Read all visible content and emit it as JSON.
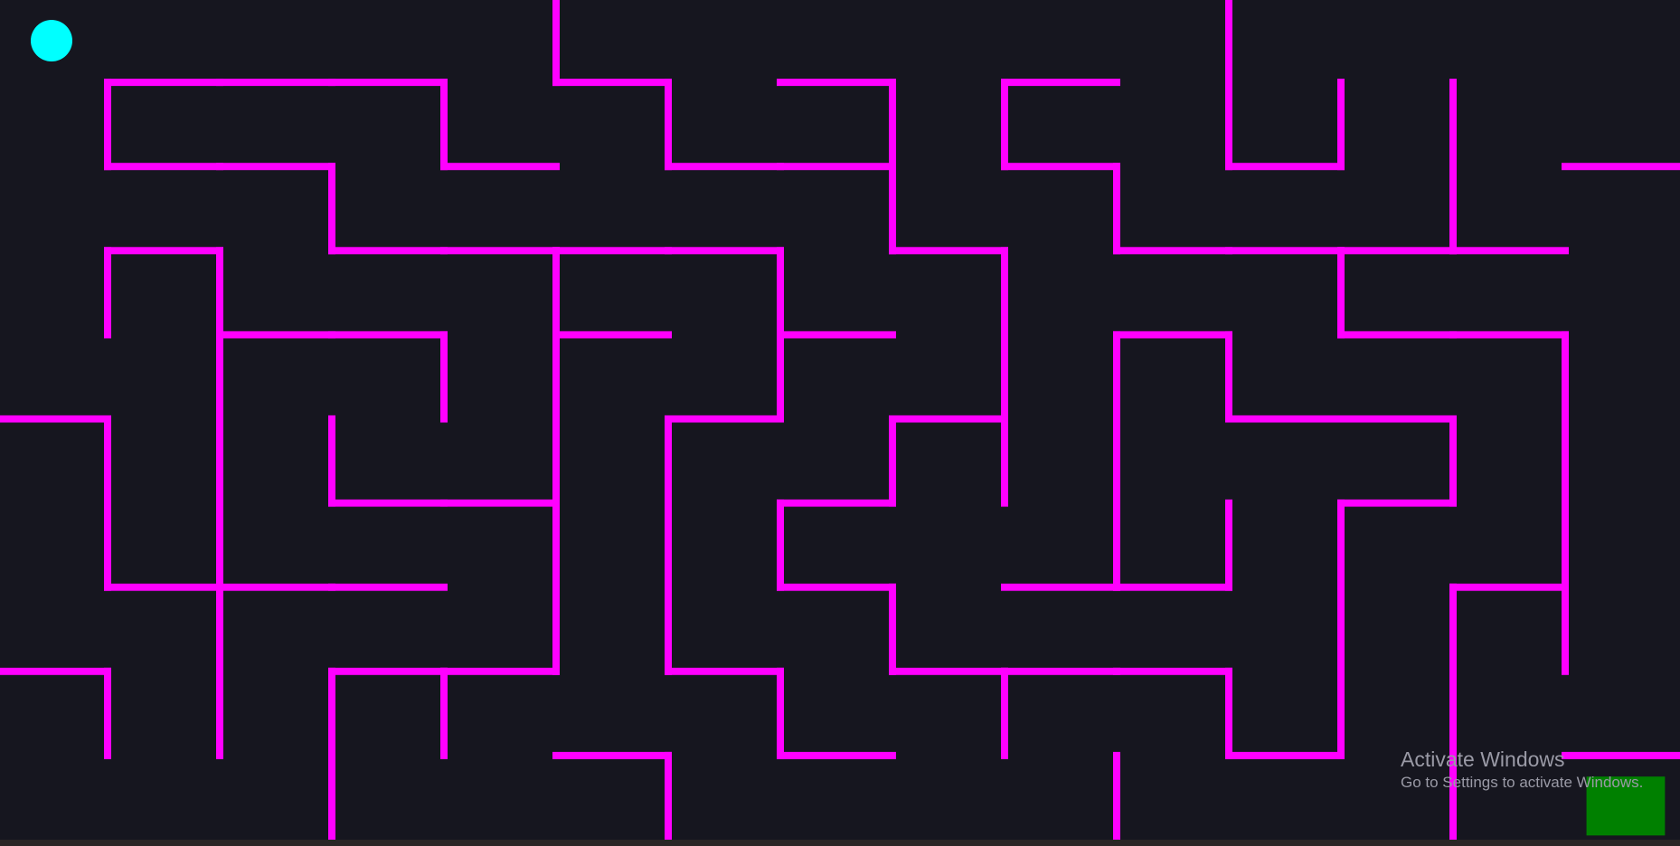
{
  "game": {
    "colors": {
      "background": "#16161f",
      "wall": "#ff00ff",
      "player": "#00ffff",
      "goal": "#008000"
    },
    "grid": {
      "rows": 10,
      "cols": 15
    },
    "player": {
      "row": 0,
      "col": 0
    },
    "goal": {
      "row": 9,
      "col": 14
    },
    "walls": {
      "horizontal": [
        [
          1,
          1
        ],
        [
          1,
          2
        ],
        [
          1,
          3
        ],
        [
          1,
          5
        ],
        [
          1,
          7
        ],
        [
          1,
          9
        ],
        [
          2,
          1
        ],
        [
          2,
          2
        ],
        [
          2,
          4
        ],
        [
          2,
          6
        ],
        [
          2,
          7
        ],
        [
          2,
          9
        ],
        [
          2,
          11
        ],
        [
          2,
          14
        ],
        [
          3,
          1
        ],
        [
          3,
          3
        ],
        [
          3,
          4
        ],
        [
          3,
          5
        ],
        [
          3,
          6
        ],
        [
          3,
          8
        ],
        [
          3,
          10
        ],
        [
          3,
          11
        ],
        [
          3,
          12
        ],
        [
          3,
          13
        ],
        [
          4,
          2
        ],
        [
          4,
          3
        ],
        [
          4,
          5
        ],
        [
          4,
          7
        ],
        [
          4,
          10
        ],
        [
          4,
          12
        ],
        [
          4,
          13
        ],
        [
          5,
          0
        ],
        [
          5,
          6
        ],
        [
          5,
          8
        ],
        [
          5,
          11
        ],
        [
          5,
          12
        ],
        [
          6,
          3
        ],
        [
          6,
          4
        ],
        [
          6,
          7
        ],
        [
          6,
          12
        ],
        [
          7,
          1
        ],
        [
          7,
          2
        ],
        [
          7,
          3
        ],
        [
          7,
          7
        ],
        [
          7,
          9
        ],
        [
          7,
          10
        ],
        [
          7,
          13
        ],
        [
          8,
          0
        ],
        [
          8,
          3
        ],
        [
          8,
          4
        ],
        [
          8,
          6
        ],
        [
          8,
          8
        ],
        [
          8,
          9
        ],
        [
          8,
          10
        ],
        [
          9,
          5
        ],
        [
          9,
          7
        ],
        [
          9,
          11
        ],
        [
          9,
          14
        ]
      ],
      "vertical": [
        [
          0,
          5
        ],
        [
          0,
          11
        ],
        [
          1,
          1
        ],
        [
          1,
          4
        ],
        [
          1,
          6
        ],
        [
          1,
          8
        ],
        [
          1,
          9
        ],
        [
          1,
          11
        ],
        [
          1,
          12
        ],
        [
          1,
          13
        ],
        [
          2,
          3
        ],
        [
          2,
          8
        ],
        [
          2,
          10
        ],
        [
          2,
          13
        ],
        [
          3,
          1
        ],
        [
          3,
          2
        ],
        [
          3,
          5
        ],
        [
          3,
          7
        ],
        [
          3,
          9
        ],
        [
          3,
          12
        ],
        [
          4,
          2
        ],
        [
          4,
          4
        ],
        [
          4,
          5
        ],
        [
          4,
          7
        ],
        [
          4,
          9
        ],
        [
          4,
          10
        ],
        [
          4,
          11
        ],
        [
          4,
          14
        ],
        [
          5,
          1
        ],
        [
          5,
          2
        ],
        [
          5,
          3
        ],
        [
          5,
          5
        ],
        [
          5,
          6
        ],
        [
          5,
          8
        ],
        [
          5,
          9
        ],
        [
          5,
          10
        ],
        [
          5,
          13
        ],
        [
          5,
          14
        ],
        [
          6,
          1
        ],
        [
          6,
          2
        ],
        [
          6,
          5
        ],
        [
          6,
          6
        ],
        [
          6,
          7
        ],
        [
          6,
          10
        ],
        [
          6,
          11
        ],
        [
          6,
          12
        ],
        [
          6,
          14
        ],
        [
          7,
          2
        ],
        [
          7,
          5
        ],
        [
          7,
          6
        ],
        [
          7,
          8
        ],
        [
          7,
          12
        ],
        [
          7,
          13
        ],
        [
          7,
          14
        ],
        [
          8,
          1
        ],
        [
          8,
          2
        ],
        [
          8,
          3
        ],
        [
          8,
          4
        ],
        [
          8,
          7
        ],
        [
          8,
          9
        ],
        [
          8,
          11
        ],
        [
          8,
          12
        ],
        [
          8,
          13
        ],
        [
          9,
          3
        ],
        [
          9,
          6
        ],
        [
          9,
          10
        ],
        [
          9,
          13
        ]
      ]
    }
  },
  "watermark": {
    "title": "Activate Windows",
    "subtitle": "Go to Settings to activate Windows."
  }
}
